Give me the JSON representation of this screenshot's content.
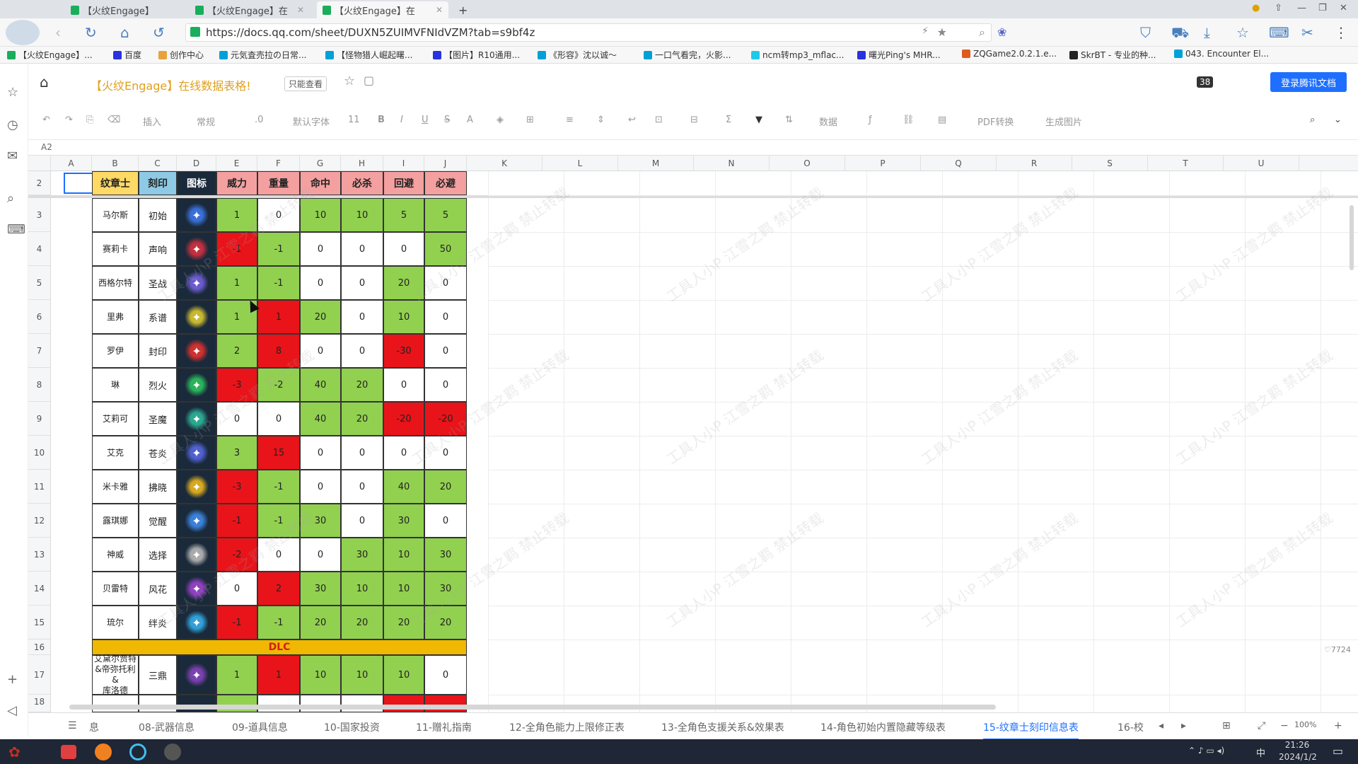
{
  "browser": {
    "tabs": [
      {
        "label": "【火纹Engage】",
        "active": false
      },
      {
        "label": "【火纹Engage】在",
        "active": false
      },
      {
        "label": "【火纹Engage】在",
        "active": true
      }
    ],
    "new_tab": "+",
    "url": "https://docs.qq.com/sheet/DUXN5ZUIMVFNIdVZM?tab=s9bf4z",
    "bookmarks": [
      "【火纹Engage】...",
      "百度",
      "创作中心",
      "元気査売拉の日常...",
      "【怪物猎人崛起曙...",
      "【图片】R10通用...",
      "《形容》沈以诚～",
      "一口气看完，火影...",
      "ncm转mp3_mflac...",
      "曙光Ping's MHR...",
      "ZQGame2.0.2.1.e...",
      "SkrBT - 专业的种...",
      "043. Encounter El..."
    ]
  },
  "doc": {
    "title": "【火纹Engage】在线数据表格!",
    "mode_badge": "只能查看",
    "collab_count": "38",
    "login_button": "登录腾讯文档"
  },
  "toolbar": {
    "insert": "插入",
    "format": "常规",
    "decimal": ".0",
    "font": "默认字体",
    "size": "11",
    "bold": "B",
    "italic": "I",
    "underline": "U",
    "strike": "S",
    "color": "A",
    "sum": "Σ",
    "data": "数据",
    "pdf": "PDF转换",
    "image": "生成图片"
  },
  "cell_ref": "A2",
  "columns": [
    "A",
    "B",
    "C",
    "D",
    "E",
    "F",
    "G",
    "H",
    "I",
    "J",
    "K",
    "L",
    "M",
    "N",
    "O",
    "P",
    "Q",
    "R",
    "S",
    "T",
    "U"
  ],
  "table": {
    "headers": [
      "纹章士",
      "刻印",
      "图标",
      "威力",
      "重量",
      "命中",
      "必杀",
      "回避",
      "必避"
    ],
    "rows": [
      {
        "n": "3",
        "name": "马尔斯",
        "mark": "初始",
        "v": [
          "1",
          "0",
          "10",
          "10",
          "5",
          "5"
        ],
        "c": [
          "g",
          "w",
          "g",
          "g",
          "g",
          "g"
        ],
        "ic": "#3a6fd8"
      },
      {
        "n": "4",
        "name": "赛莉卡",
        "mark": "声响",
        "v": [
          "-1",
          "-1",
          "0",
          "0",
          "0",
          "50"
        ],
        "c": [
          "r",
          "g",
          "w",
          "w",
          "w",
          "g"
        ],
        "ic": "#c23040"
      },
      {
        "n": "5",
        "name": "西格尔特",
        "mark": "圣战",
        "v": [
          "1",
          "-1",
          "0",
          "0",
          "20",
          "0"
        ],
        "c": [
          "g",
          "g",
          "w",
          "w",
          "g",
          "w"
        ],
        "ic": "#6a5acd"
      },
      {
        "n": "6",
        "name": "里弗",
        "mark": "系谱",
        "v": [
          "1",
          "1",
          "20",
          "0",
          "10",
          "0"
        ],
        "c": [
          "g",
          "r",
          "g",
          "w",
          "g",
          "w"
        ],
        "ic": "#c8b830"
      },
      {
        "n": "7",
        "name": "罗伊",
        "mark": "封印",
        "v": [
          "2",
          "8",
          "0",
          "0",
          "-30",
          "0"
        ],
        "c": [
          "g",
          "r",
          "w",
          "w",
          "r",
          "w"
        ],
        "ic": "#d03030"
      },
      {
        "n": "8",
        "name": "琳",
        "mark": "烈火",
        "v": [
          "-3",
          "-2",
          "40",
          "20",
          "0",
          "0"
        ],
        "c": [
          "r",
          "g",
          "g",
          "g",
          "w",
          "w"
        ],
        "ic": "#2bb35a"
      },
      {
        "n": "9",
        "name": "艾莉可",
        "mark": "圣魔",
        "v": [
          "0",
          "0",
          "40",
          "20",
          "-20",
          "-20"
        ],
        "c": [
          "w",
          "w",
          "g",
          "g",
          "r",
          "r"
        ],
        "ic": "#2aa890"
      },
      {
        "n": "10",
        "name": "艾克",
        "mark": "苍炎",
        "v": [
          "3",
          "15",
          "0",
          "0",
          "0",
          "0"
        ],
        "c": [
          "g",
          "r",
          "w",
          "w",
          "w",
          "w"
        ],
        "ic": "#5060d0"
      },
      {
        "n": "11",
        "name": "米卡雅",
        "mark": "拂晓",
        "v": [
          "-3",
          "-1",
          "0",
          "0",
          "40",
          "20"
        ],
        "c": [
          "r",
          "g",
          "w",
          "w",
          "g",
          "g"
        ],
        "ic": "#d8a820"
      },
      {
        "n": "12",
        "name": "露琪娜",
        "mark": "觉醒",
        "v": [
          "-1",
          "-1",
          "30",
          "0",
          "30",
          "0"
        ],
        "c": [
          "r",
          "g",
          "g",
          "w",
          "g",
          "w"
        ],
        "ic": "#3a80d8"
      },
      {
        "n": "13",
        "name": "神威",
        "mark": "选择",
        "v": [
          "-2",
          "0",
          "0",
          "30",
          "10",
          "30"
        ],
        "c": [
          "r",
          "w",
          "w",
          "g",
          "g",
          "g"
        ],
        "ic": "#aaaaaa"
      },
      {
        "n": "14",
        "name": "贝雷特",
        "mark": "风花",
        "v": [
          "0",
          "2",
          "30",
          "10",
          "10",
          "30"
        ],
        "c": [
          "w",
          "r",
          "g",
          "g",
          "g",
          "g"
        ],
        "ic": "#9040c0"
      },
      {
        "n": "15",
        "name": "琉尔",
        "mark": "绊炎",
        "v": [
          "-1",
          "-1",
          "20",
          "20",
          "20",
          "20"
        ],
        "c": [
          "r",
          "g",
          "g",
          "g",
          "g",
          "g"
        ],
        "ic": "#30a0d8"
      }
    ],
    "dlc_row": {
      "n": "16",
      "label": "DLC"
    },
    "row17": {
      "n": "17",
      "name": "艾黛尔贾特\n&帝弥托利&\n库洛德",
      "mark": "三鼎",
      "v": [
        "1",
        "1",
        "10",
        "10",
        "10",
        "0"
      ],
      "c": [
        "g",
        "r",
        "g",
        "g",
        "g",
        "w"
      ],
      "ic": "#7a40b0"
    },
    "row18": {
      "n": "18"
    }
  },
  "row2_n": "2",
  "sheets": [
    "息",
    "08-武器信息",
    "09-道具信息",
    "10-国家投资",
    "11-赠礼指南",
    "12-全角色能力上限修正表",
    "13-全角色支援关系&效果表",
    "14-角色初始内置隐藏等级表",
    "15-纹章士刻印信息表",
    "16-校"
  ],
  "active_sheet": "15-纹章士刻印信息表",
  "zoom": "100%",
  "like_count": "7724",
  "taskbar": {
    "time": "21:26",
    "date": "2024/1/2",
    "ime": "中"
  },
  "watermark": "工具人小P 江雪之羁 禁止转载",
  "colors": {
    "green": "#92d050",
    "red": "#e8141a",
    "yellow": "#ffd966",
    "blue": "#8ecae6",
    "pink": "#f4a0a0",
    "dlc": "#f0b800",
    "dark": "#1a2a3a"
  }
}
